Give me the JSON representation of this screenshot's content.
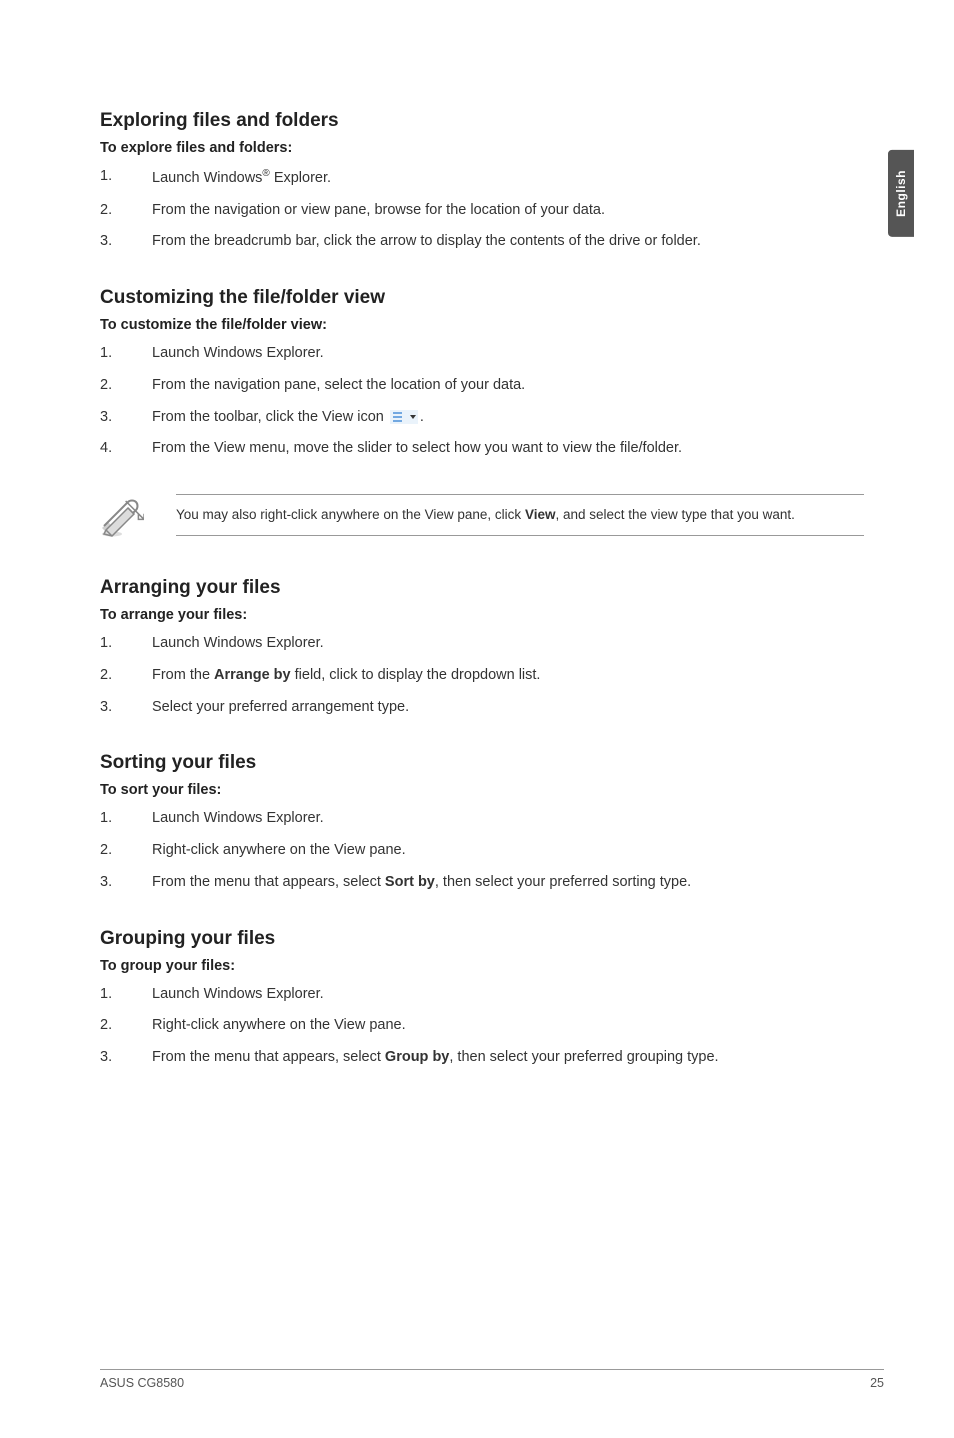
{
  "side_tab": "English",
  "sections": {
    "exploring": {
      "heading": "Exploring files and folders",
      "sub": "To explore files and folders:",
      "items": [
        {
          "n": "1.",
          "text_before": "Launch Windows",
          "sup": "®",
          "text_after": " Explorer."
        },
        {
          "n": "2.",
          "text": "From the navigation or view pane, browse for the location of your data."
        },
        {
          "n": "3.",
          "text": "From the breadcrumb bar, click the arrow to display the contents of the drive or folder."
        }
      ]
    },
    "customizing": {
      "heading": "Customizing the file/folder view",
      "sub": "To customize the file/folder view:",
      "items": [
        {
          "n": "1.",
          "text": "Launch Windows Explorer."
        },
        {
          "n": "2.",
          "text": "From the navigation pane, select the location of your data."
        },
        {
          "n": "3.",
          "text_before": "From the toolbar, click the View icon ",
          "text_after": "."
        },
        {
          "n": "4.",
          "text": "From the View menu, move the slider to select how you want to view the file/folder."
        }
      ]
    },
    "note": {
      "text_before": "You may also right-click anywhere on the View pane, click ",
      "bold": "View",
      "text_after": ", and select the view type that you want."
    },
    "arranging": {
      "heading": "Arranging your files",
      "sub": "To arrange your files:",
      "items": [
        {
          "n": "1.",
          "text": "Launch Windows Explorer."
        },
        {
          "n": "2.",
          "text_before": "From the ",
          "bold": "Arrange by",
          "text_after": " field, click to display the dropdown list."
        },
        {
          "n": "3.",
          "text": "Select your preferred arrangement type."
        }
      ]
    },
    "sorting": {
      "heading": "Sorting your files",
      "sub": "To sort your files:",
      "items": [
        {
          "n": "1.",
          "text": "Launch Windows Explorer."
        },
        {
          "n": "2.",
          "text": "Right-click anywhere on the View pane."
        },
        {
          "n": "3.",
          "text_before": "From the menu that appears, select ",
          "bold": "Sort by",
          "text_after": ", then select your preferred sorting type."
        }
      ]
    },
    "grouping": {
      "heading": "Grouping your files",
      "sub": "To group your files:",
      "items": [
        {
          "n": "1.",
          "text": "Launch Windows Explorer."
        },
        {
          "n": "2.",
          "text": "Right-click anywhere on the View pane."
        },
        {
          "n": "3.",
          "text_before": "From the menu that appears, select ",
          "bold": "Group by",
          "text_after": ", then select your preferred grouping type."
        }
      ]
    }
  },
  "footer": {
    "left": "ASUS CG8580",
    "right": "25"
  }
}
